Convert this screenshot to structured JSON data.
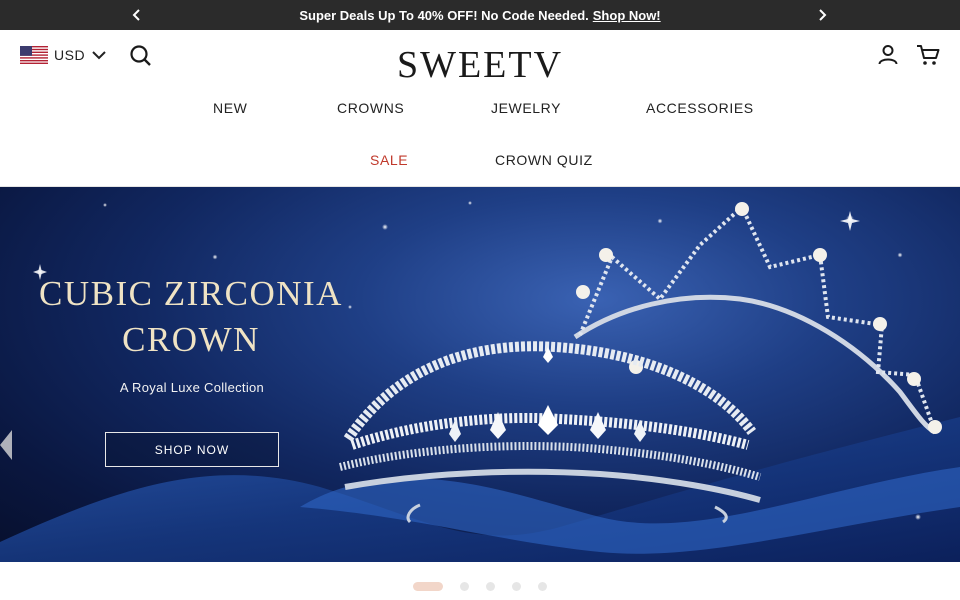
{
  "announcement": {
    "text": "Super Deals Up To 40% OFF! No Code Needed.",
    "link": "Shop Now!"
  },
  "header": {
    "currency": "USD",
    "logo": "SWEETV",
    "nav": [
      "NEW",
      "CROWNS",
      "JEWELRY",
      "ACCESSORIES",
      "SALE",
      "CROWN QUIZ"
    ]
  },
  "hero": {
    "title_line1": "CUBIC ZIRCONIA",
    "title_line2": "CROWN",
    "subtitle": "A Royal Luxe Collection",
    "button": "SHOP NOW"
  },
  "carousel": {
    "slide_count": 5,
    "active_index": 0
  },
  "colors": {
    "announcement_bg": "#2b2b2b",
    "sale": "#c0392b",
    "hero_bg": "#112760",
    "hero_title": "#efe3c4",
    "active_dot": "#f2d6c9"
  }
}
